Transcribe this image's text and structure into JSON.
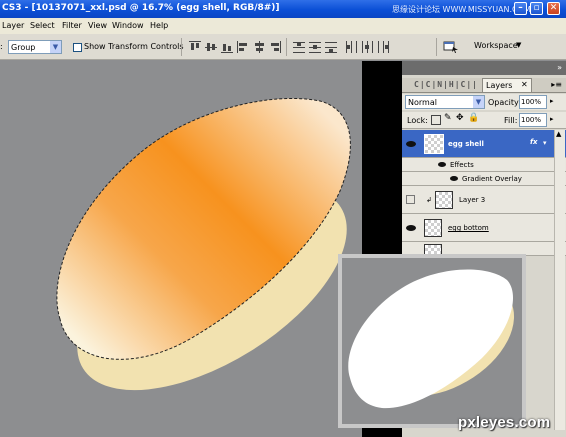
{
  "window": {
    "title": "CS3 - [10137071_xxl.psd @ 16.7% (egg shell, RGB/8#)]",
    "site_watermark": "思缘设计论坛  WWW.MISSYUAN.COM"
  },
  "menu": [
    "Layer",
    "Select",
    "Filter",
    "View",
    "Window",
    "Help"
  ],
  "options": {
    "auto_select_value": "Group",
    "show_transform_label": "Show Transform Controls",
    "workspace_label": "Workspace"
  },
  "layers_panel": {
    "tab_glyphs": "C∣C∣N∣H∣C∣∣",
    "tab_label": "Layers",
    "blend_mode": "Normal",
    "opacity_label": "Opacity:",
    "opacity_value": "100%",
    "lock_label": "Lock:",
    "fill_label": "Fill:",
    "fill_value": "100%",
    "layers": [
      {
        "name": "egg shell",
        "selected": true,
        "fx": "fx"
      },
      {
        "name": "Effects"
      },
      {
        "name": "Gradient Overlay"
      },
      {
        "name": "Layer 3"
      },
      {
        "name": "egg bottom"
      }
    ]
  },
  "watermark": "pxleyes.com",
  "colors": {
    "titlebar": "#0b4fd6",
    "selected_layer": "#3a67c4",
    "egg_orange": "#f7921e",
    "egg_cream": "#f5e6b8"
  }
}
